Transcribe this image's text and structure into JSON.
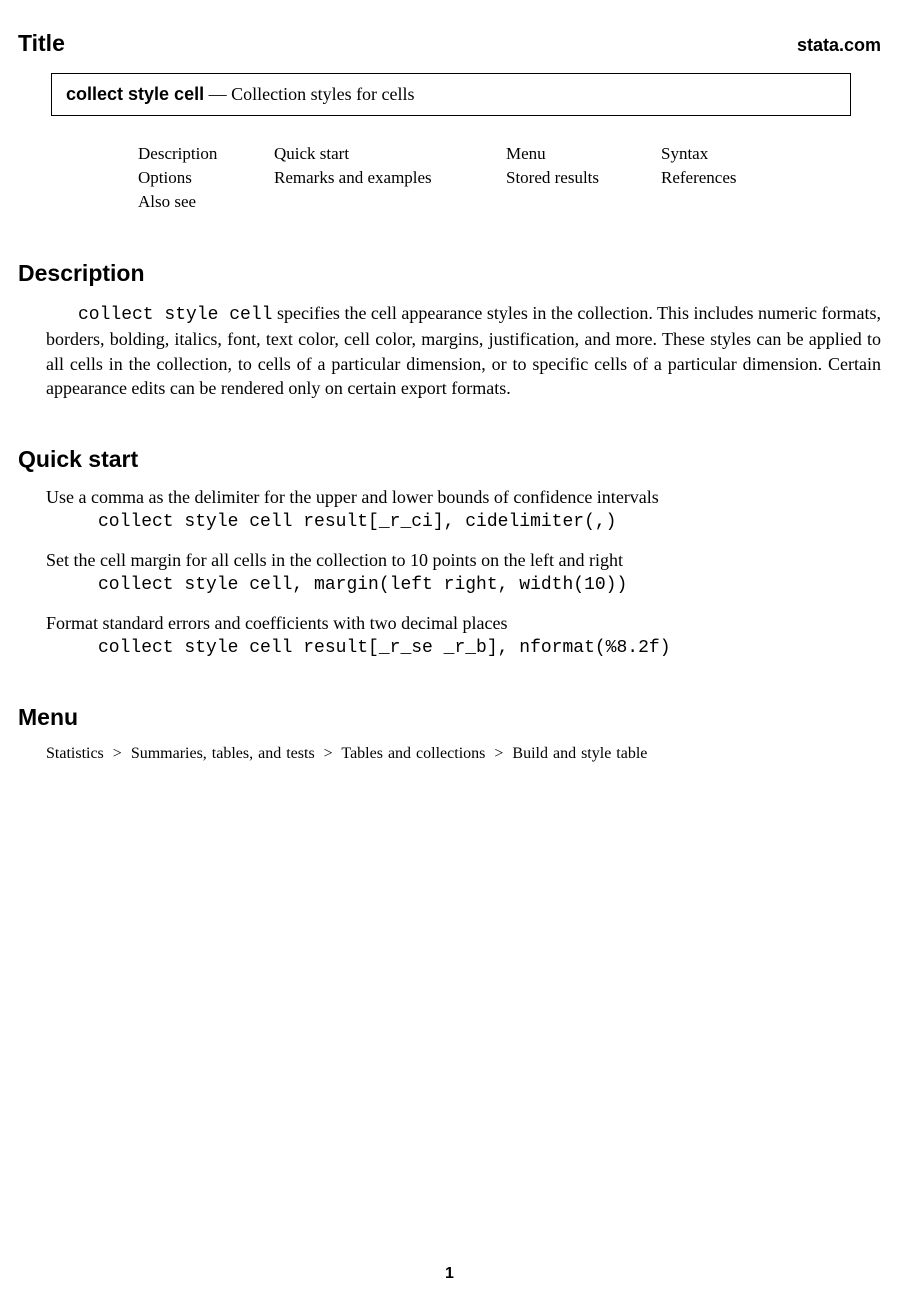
{
  "header": {
    "title": "Title",
    "site": "stata.com"
  },
  "title_box": {
    "command": "collect style cell",
    "sep": " — ",
    "subtitle": "Collection styles for cells"
  },
  "toc": {
    "rows": [
      [
        "Description",
        "Quick start",
        "Menu",
        "Syntax"
      ],
      [
        "Options",
        "Remarks and examples",
        "Stored results",
        "References"
      ],
      [
        "Also see",
        "",
        "",
        ""
      ]
    ]
  },
  "description": {
    "heading": "Description",
    "lead_code": "collect style cell",
    "body_rest": " specifies the cell appearance styles in the collection. This includes numeric formats, borders, bolding, italics, font, text color, cell color, margins, justification, and more. These styles can be applied to all cells in the collection, to cells of a particular dimension, or to specific cells of a particular dimension. Certain appearance edits can be rendered only on certain export formats."
  },
  "quick_start": {
    "heading": "Quick start",
    "items": [
      {
        "text": "Use a comma as the delimiter for the upper and lower bounds of confidence intervals",
        "code": "collect style cell result[_r_ci], cidelimiter(,)"
      },
      {
        "text": "Set the cell margin for all cells in the collection to 10 points on the left and right",
        "code": "collect style cell, margin(left right, width(10))"
      },
      {
        "text": "Format standard errors and coefficients with two decimal places",
        "code": "collect style cell result[_r_se _r_b], nformat(%8.2f)"
      }
    ]
  },
  "menu": {
    "heading": "Menu",
    "path": [
      "Statistics",
      "Summaries, tables, and tests",
      "Tables and collections",
      "Build and style table"
    ]
  },
  "page_number": "1"
}
